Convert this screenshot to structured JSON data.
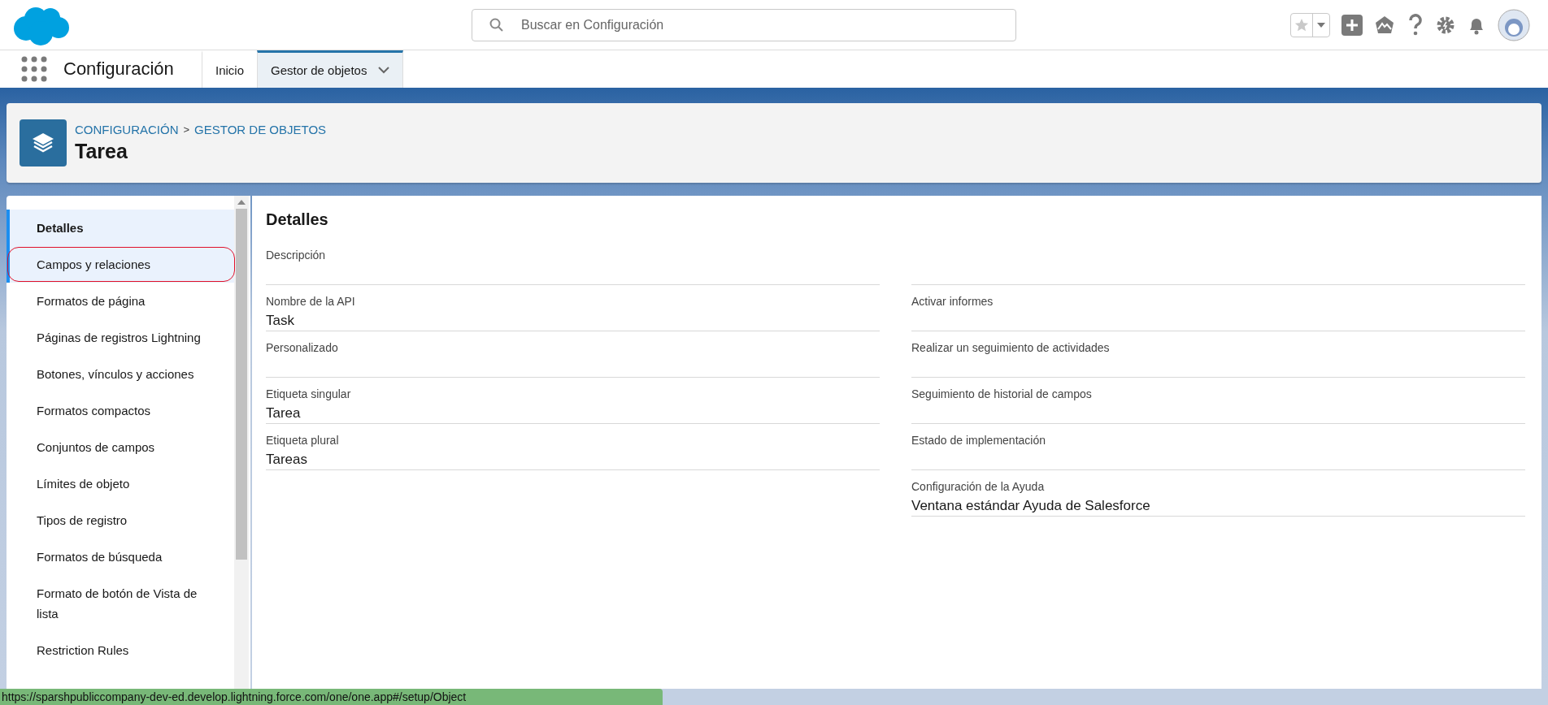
{
  "search": {
    "placeholder": "Buscar en Configuración"
  },
  "nav": {
    "app_name": "Configuración",
    "tabs": [
      {
        "label": "Inicio",
        "selected": false,
        "dropdown": false
      },
      {
        "label": "Gestor de objetos",
        "selected": true,
        "dropdown": true
      }
    ]
  },
  "header": {
    "breadcrumbs": [
      "CONFIGURACIÓN",
      "GESTOR DE OBJETOS"
    ],
    "separator": ">",
    "title": "Tarea"
  },
  "sidebar": {
    "items": [
      {
        "label": "Detalles",
        "selected": true,
        "hovered": false,
        "circled": false
      },
      {
        "label": "Campos y relaciones",
        "selected": false,
        "hovered": true,
        "circled": true
      },
      {
        "label": "Formatos de página",
        "selected": false,
        "hovered": false,
        "circled": false
      },
      {
        "label": "Páginas de registros Lightning",
        "selected": false,
        "hovered": false,
        "circled": false
      },
      {
        "label": "Botones, vínculos y acciones",
        "selected": false,
        "hovered": false,
        "circled": false
      },
      {
        "label": "Formatos compactos",
        "selected": false,
        "hovered": false,
        "circled": false
      },
      {
        "label": "Conjuntos de campos",
        "selected": false,
        "hovered": false,
        "circled": false
      },
      {
        "label": "Límites de objeto",
        "selected": false,
        "hovered": false,
        "circled": false
      },
      {
        "label": "Tipos de registro",
        "selected": false,
        "hovered": false,
        "circled": false
      },
      {
        "label": "Formatos de búsqueda",
        "selected": false,
        "hovered": false,
        "circled": false
      },
      {
        "label": "Formato de botón de Vista de lista",
        "selected": false,
        "hovered": false,
        "circled": false
      },
      {
        "label": "Restriction Rules",
        "selected": false,
        "hovered": false,
        "circled": false
      }
    ]
  },
  "details": {
    "title": "Detalles",
    "rows": [
      {
        "left": {
          "label": "Descripción"
        },
        "right": {}
      },
      {
        "left": {
          "label": "Nombre de la API",
          "value": "Task"
        },
        "right": {
          "label": "Activar informes"
        }
      },
      {
        "left": {
          "label": "Personalizado"
        },
        "right": {
          "label": "Realizar un seguimiento de actividades"
        }
      },
      {
        "left": {
          "label": "Etiqueta singular",
          "value": "Tarea"
        },
        "right": {
          "label": "Seguimiento de historial de campos"
        }
      },
      {
        "left": {
          "label": "Etiqueta plural",
          "value": "Tareas"
        },
        "right": {
          "label": "Estado de implementación"
        }
      },
      {
        "right": {
          "label": "Configuración de la Ayuda",
          "value": "Ventana estándar Ayuda de Salesforce"
        }
      }
    ]
  },
  "status_bar": {
    "url": "https://sparshpubliccompany-dev-ed.develop.lightning.force.com/one/one.app#/setup/Object"
  }
}
